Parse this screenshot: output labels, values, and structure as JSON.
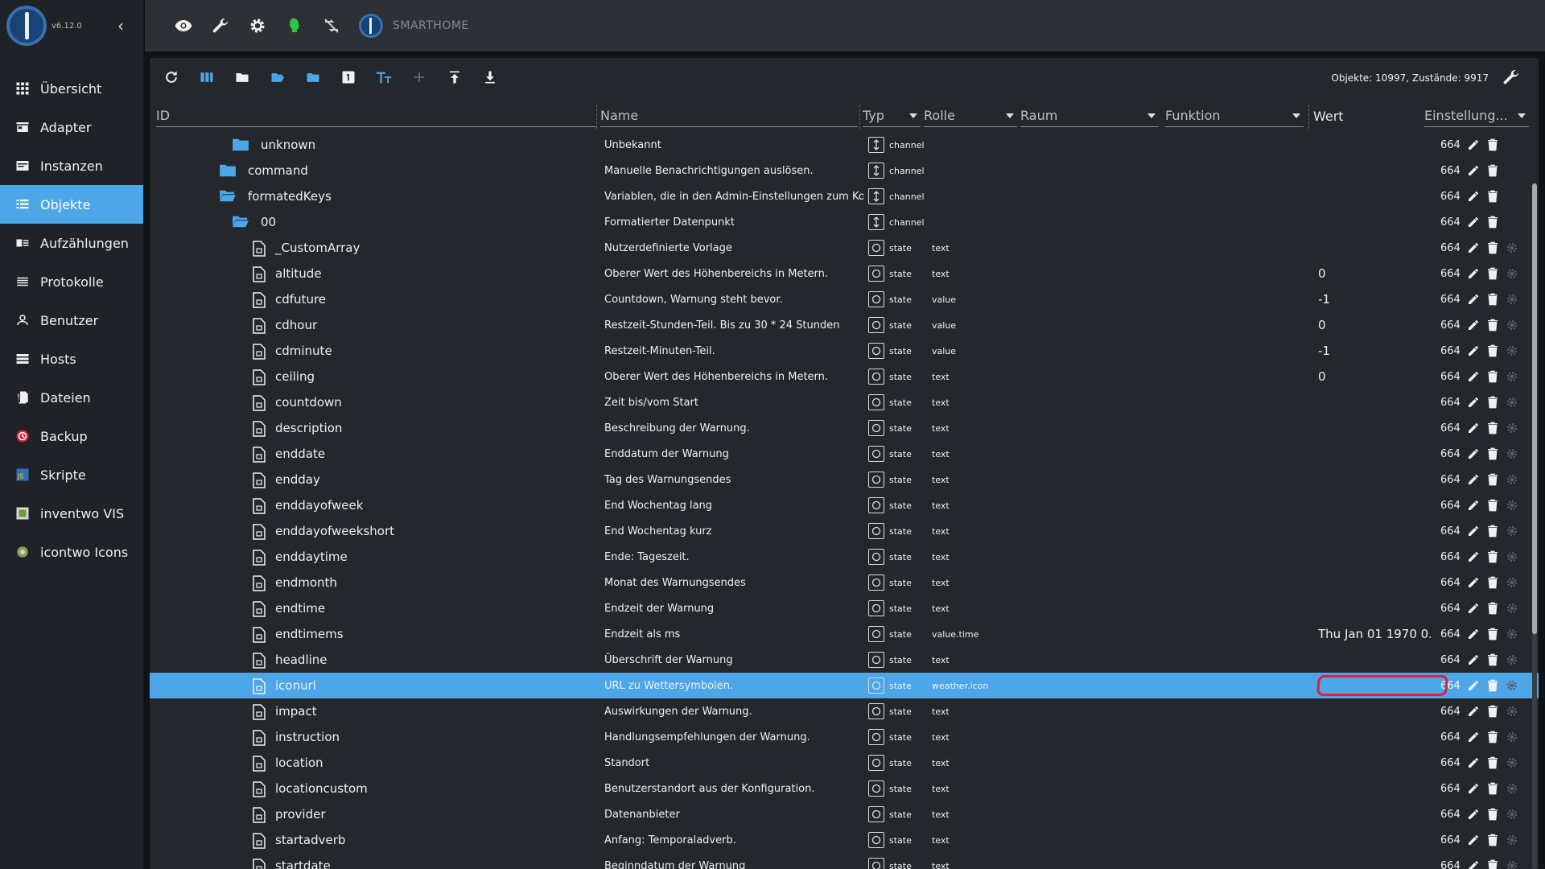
{
  "sidebar": {
    "version": "v6.12.0",
    "items": [
      {
        "label": "Übersicht",
        "icon": "grid-icon"
      },
      {
        "label": "Adapter",
        "icon": "store-icon"
      },
      {
        "label": "Instanzen",
        "icon": "instances-icon"
      },
      {
        "label": "Objekte",
        "icon": "list-icon",
        "active": true
      },
      {
        "label": "Aufzählungen",
        "icon": "enum-icon"
      },
      {
        "label": "Protokolle",
        "icon": "log-icon"
      },
      {
        "label": "Benutzer",
        "icon": "user-icon"
      },
      {
        "label": "Hosts",
        "icon": "hosts-icon"
      },
      {
        "label": "Dateien",
        "icon": "files-icon"
      },
      {
        "label": "Backup",
        "icon": "backup-icon"
      },
      {
        "label": "Skripte",
        "icon": "scripts-icon"
      },
      {
        "label": "inventwo VIS",
        "icon": "vis-icon"
      },
      {
        "label": "icontwo Icons",
        "icon": "icons-icon"
      }
    ]
  },
  "topbar": {
    "title": "SMARTHOME"
  },
  "toolbar": {
    "objects_count": "Objekte: 10997, Zustände: 9917"
  },
  "columns": {
    "id": "ID",
    "name": "Name",
    "type": "Typ",
    "role": "Rolle",
    "room": "Raum",
    "function": "Funktion",
    "value": "Wert",
    "settings": "Einstellung..."
  },
  "colors": {
    "accent": "#4da6e8",
    "highlight": "#e0203b"
  },
  "rows": [
    {
      "id": "unknown",
      "indent": 1,
      "kind": "folder",
      "name": "Unbekannt",
      "type": "channel",
      "role": "",
      "value": "",
      "acl": "664"
    },
    {
      "id": "command",
      "indent": 0,
      "kind": "folder",
      "name": "Manuelle Benachrichtigungen auslösen.",
      "type": "channel",
      "role": "",
      "value": "",
      "acl": "664"
    },
    {
      "id": "formatedKeys",
      "indent": 0,
      "kind": "folder-open",
      "name": "Variablen, die in den Admin-Einstellungen zum Kon...",
      "type": "channel",
      "role": "",
      "value": "",
      "acl": "664"
    },
    {
      "id": "00",
      "indent": 1,
      "kind": "folder-open",
      "name": "Formatierter Datenpunkt",
      "type": "channel",
      "role": "",
      "value": "",
      "acl": "664"
    },
    {
      "id": "_CustomArray",
      "indent": 2,
      "kind": "file",
      "name": "Nutzerdefinierte Vorlage",
      "type": "state",
      "role": "text",
      "value": "",
      "acl": "664"
    },
    {
      "id": "altitude",
      "indent": 2,
      "kind": "file",
      "name": "Oberer Wert des Höhenbereichs in Metern.",
      "type": "state",
      "role": "text",
      "value": "0",
      "acl": "664"
    },
    {
      "id": "cdfuture",
      "indent": 2,
      "kind": "file",
      "name": "Countdown, Warnung steht bevor.",
      "type": "state",
      "role": "value",
      "value": "-1",
      "acl": "664"
    },
    {
      "id": "cdhour",
      "indent": 2,
      "kind": "file",
      "name": "Restzeit-Stunden-Teil. Bis zu 30 * 24 Stunden",
      "type": "state",
      "role": "value",
      "value": "0",
      "acl": "664"
    },
    {
      "id": "cdminute",
      "indent": 2,
      "kind": "file",
      "name": "Restzeit-Minuten-Teil.",
      "type": "state",
      "role": "value",
      "value": "-1",
      "acl": "664"
    },
    {
      "id": "ceiling",
      "indent": 2,
      "kind": "file",
      "name": "Oberer Wert des Höhenbereichs in Metern.",
      "type": "state",
      "role": "text",
      "value": "0",
      "acl": "664"
    },
    {
      "id": "countdown",
      "indent": 2,
      "kind": "file",
      "name": "Zeit bis/vom Start",
      "type": "state",
      "role": "text",
      "value": "",
      "acl": "664"
    },
    {
      "id": "description",
      "indent": 2,
      "kind": "file",
      "name": "Beschreibung der Warnung.",
      "type": "state",
      "role": "text",
      "value": "",
      "acl": "664"
    },
    {
      "id": "enddate",
      "indent": 2,
      "kind": "file",
      "name": "Enddatum der Warnung",
      "type": "state",
      "role": "text",
      "value": "",
      "acl": "664"
    },
    {
      "id": "endday",
      "indent": 2,
      "kind": "file",
      "name": "Tag des Warnungsendes",
      "type": "state",
      "role": "text",
      "value": "",
      "acl": "664"
    },
    {
      "id": "enddayofweek",
      "indent": 2,
      "kind": "file",
      "name": "End Wochentag lang",
      "type": "state",
      "role": "text",
      "value": "",
      "acl": "664"
    },
    {
      "id": "enddayofweekshort",
      "indent": 2,
      "kind": "file",
      "name": "End Wochentag kurz",
      "type": "state",
      "role": "text",
      "value": "",
      "acl": "664"
    },
    {
      "id": "enddaytime",
      "indent": 2,
      "kind": "file",
      "name": "Ende: Tageszeit.",
      "type": "state",
      "role": "text",
      "value": "",
      "acl": "664"
    },
    {
      "id": "endmonth",
      "indent": 2,
      "kind": "file",
      "name": "Monat des Warnungsendes",
      "type": "state",
      "role": "text",
      "value": "",
      "acl": "664"
    },
    {
      "id": "endtime",
      "indent": 2,
      "kind": "file",
      "name": "Endzeit der Warnung",
      "type": "state",
      "role": "text",
      "value": "",
      "acl": "664"
    },
    {
      "id": "endtimems",
      "indent": 2,
      "kind": "file",
      "name": "Endzeit als ms",
      "type": "state",
      "role": "value.time",
      "value": "Thu Jan 01 1970 0...",
      "acl": "664"
    },
    {
      "id": "headline",
      "indent": 2,
      "kind": "file",
      "name": "Überschrift der Warnung",
      "type": "state",
      "role": "text",
      "value": "",
      "acl": "664"
    },
    {
      "id": "iconurl",
      "indent": 2,
      "kind": "file",
      "name": "URL zu Wettersymbolen.",
      "type": "state",
      "role": "weather.icon",
      "value": "",
      "acl": "664",
      "selected": true
    },
    {
      "id": "impact",
      "indent": 2,
      "kind": "file",
      "name": "Auswirkungen der Warnung.",
      "type": "state",
      "role": "text",
      "value": "",
      "acl": "664"
    },
    {
      "id": "instruction",
      "indent": 2,
      "kind": "file",
      "name": "Handlungsempfehlungen der Warnung.",
      "type": "state",
      "role": "text",
      "value": "",
      "acl": "664"
    },
    {
      "id": "location",
      "indent": 2,
      "kind": "file",
      "name": "Standort",
      "type": "state",
      "role": "text",
      "value": "",
      "acl": "664"
    },
    {
      "id": "locationcustom",
      "indent": 2,
      "kind": "file",
      "name": "Benutzerstandort aus der Konfiguration.",
      "type": "state",
      "role": "text",
      "value": "",
      "acl": "664"
    },
    {
      "id": "provider",
      "indent": 2,
      "kind": "file",
      "name": "Datenanbieter",
      "type": "state",
      "role": "text",
      "value": "",
      "acl": "664"
    },
    {
      "id": "startadverb",
      "indent": 2,
      "kind": "file",
      "name": "Anfang: Temporaladverb.",
      "type": "state",
      "role": "text",
      "value": "",
      "acl": "664"
    },
    {
      "id": "startdate",
      "indent": 2,
      "kind": "file",
      "name": "Beginndatum der Warnung",
      "type": "state",
      "role": "text",
      "value": "",
      "acl": "664"
    }
  ]
}
